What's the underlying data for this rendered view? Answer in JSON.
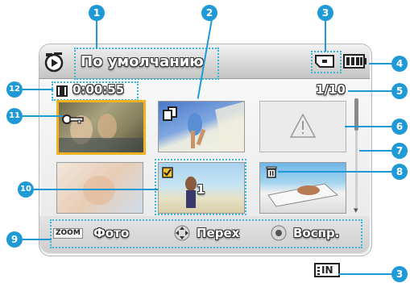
{
  "header": {
    "title": "По умолчанию"
  },
  "status": {
    "elapsed_time": "0:00:55",
    "page_counter": "1/10"
  },
  "thumbnails": {
    "multi_select_count": "1"
  },
  "bottom_bar": {
    "zoom_key": "ZOOM",
    "photo_label": "Фото",
    "move_label": "Перех",
    "play_label": "Воспр."
  },
  "in_indicator": {
    "label": "IN"
  },
  "callouts": [
    "1",
    "2",
    "3",
    "4",
    "5",
    "6",
    "7",
    "8",
    "9",
    "10",
    "11",
    "12",
    "3"
  ],
  "colors": {
    "callout": "#1f9ad6",
    "selection": "#f2b321",
    "dotted_highlight": "#39b5d9"
  }
}
